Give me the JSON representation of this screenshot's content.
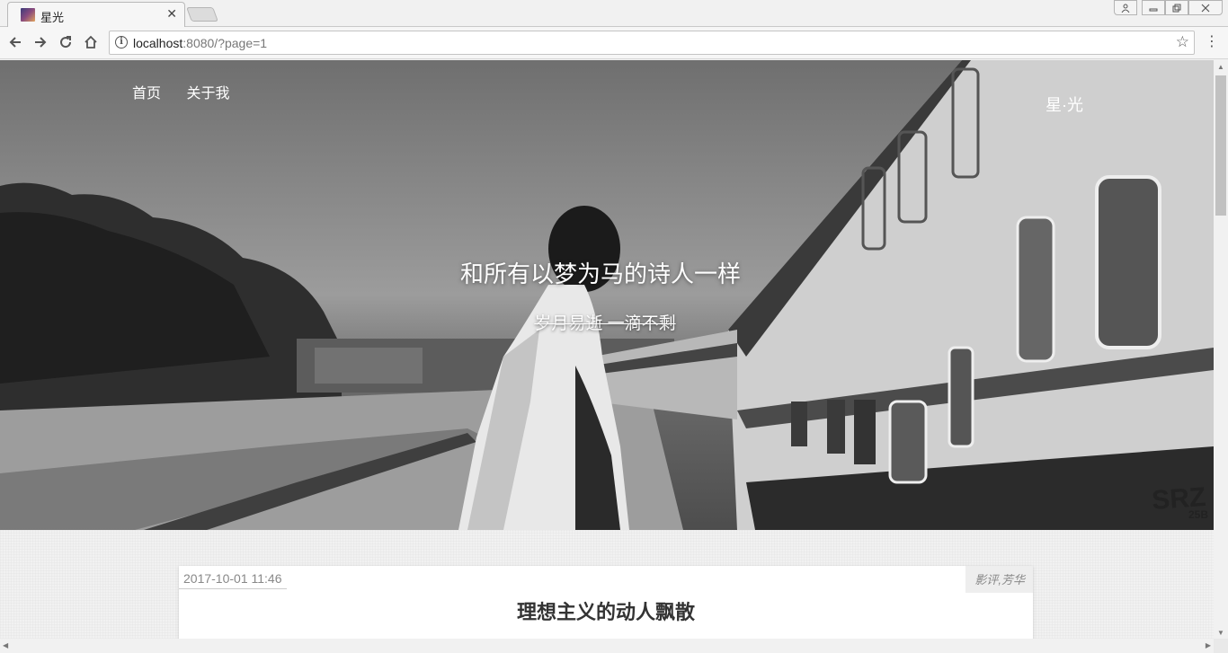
{
  "browser": {
    "tab_title": "星光",
    "url_host": "localhost",
    "url_rest": ":8080/?page=1"
  },
  "icons": {
    "back": "arrow-left-icon",
    "forward": "arrow-right-icon",
    "reload": "reload-icon",
    "home": "home-icon",
    "info": "info-icon",
    "bookmark": "star-icon",
    "menu": "more-vertical-icon"
  },
  "nav": {
    "items": [
      "首页",
      "关于我"
    ],
    "brand": "星·光"
  },
  "hero": {
    "title": "和所有以梦为马的诗人一样",
    "subtitle": "岁月易逝 一滴不剩"
  },
  "post": {
    "date": "2017-10-01 11:46",
    "tags": "影评,芳华",
    "title": "理想主义的动人飘散"
  }
}
